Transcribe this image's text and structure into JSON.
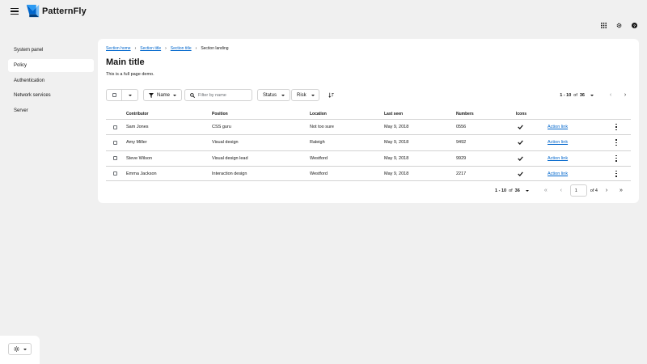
{
  "brand": {
    "name": "PatternFly"
  },
  "masthead": {
    "menu_icon": "hamburger-icon",
    "tools": [
      "grid-icon",
      "gear-icon",
      "help-icon"
    ]
  },
  "sidebar": {
    "items": [
      {
        "label": "System panel",
        "active": false
      },
      {
        "label": "Policy",
        "active": true
      },
      {
        "label": "Authentication",
        "active": false
      },
      {
        "label": "Network services",
        "active": false
      },
      {
        "label": "Server",
        "active": false
      }
    ],
    "theme_icon": "sun-icon"
  },
  "breadcrumb": {
    "items": [
      "Section home",
      "Section title",
      "Section title"
    ],
    "current": "Section landing"
  },
  "page": {
    "title": "Main title",
    "description": "This is a full page demo."
  },
  "toolbar": {
    "filter_attribute": "Name",
    "search_placeholder": "Filter by name",
    "status_label": "Status",
    "risk_label": "Risk",
    "pagination": {
      "range": "1 - 10",
      "of": "of",
      "total": "36"
    }
  },
  "table": {
    "columns": [
      "Contributor",
      "Position",
      "Location",
      "Last seen",
      "Numbers",
      "Icons",
      ""
    ],
    "rows": [
      {
        "contributor": "Sam Jones",
        "position": "CSS guru",
        "location": "Not too sure",
        "last_seen": "May 9, 2018",
        "numbers": "0556",
        "icon": "check-icon",
        "action": "Action link"
      },
      {
        "contributor": "Amy Miller",
        "position": "Visual design",
        "location": "Raleigh",
        "last_seen": "May 9, 2018",
        "numbers": "9492",
        "icon": "check-icon",
        "action": "Action link"
      },
      {
        "contributor": "Steve Wilson",
        "position": "Visual design lead",
        "location": "Westford",
        "last_seen": "May 9, 2018",
        "numbers": "9929",
        "icon": "check-icon",
        "action": "Action link"
      },
      {
        "contributor": "Emma Jackson",
        "position": "Interaction design",
        "location": "Westford",
        "last_seen": "May 9, 2018",
        "numbers": "2217",
        "icon": "check-icon",
        "action": "Action link"
      }
    ]
  },
  "bottom_pagination": {
    "range": "1 - 10",
    "of": "of",
    "total": "36",
    "current_page": "1",
    "page_count_text": "of 4"
  },
  "colors": {
    "link": "#0066cc",
    "background": "#f0f0f0",
    "card": "#ffffff",
    "border": "#d2d2d2",
    "logo_blue": "#2b9af3"
  }
}
